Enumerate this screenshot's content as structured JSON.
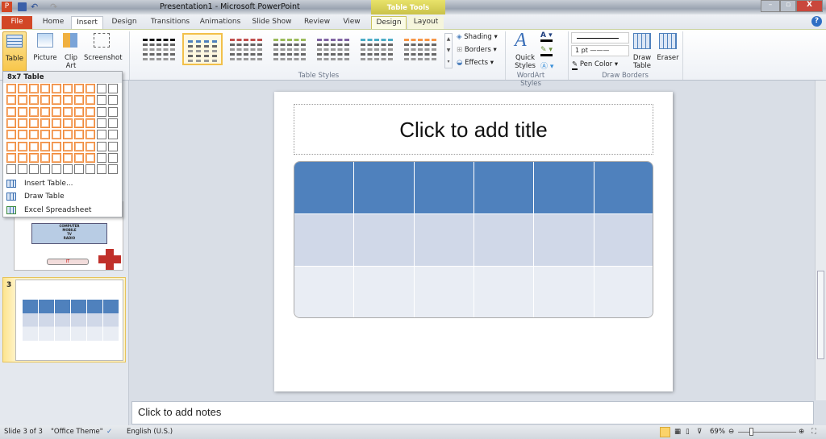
{
  "window": {
    "title": "Presentation1 - Microsoft PowerPoint",
    "contextual_group": "Table Tools"
  },
  "tabs": [
    "File",
    "Home",
    "Insert",
    "Design",
    "Transitions",
    "Animations",
    "Slide Show",
    "Review",
    "View",
    "Design",
    "Layout"
  ],
  "ribbon": {
    "tables": {
      "table": "Table",
      "picture": "Picture",
      "clip_art": "Clip Art",
      "screenshot": "Screenshot"
    },
    "table_styles_label": "Table Styles",
    "style_colors": [
      "#111111",
      "#4f81bd",
      "#c0504d",
      "#9bbb59",
      "#8064a2",
      "#4bacc6",
      "#f79646"
    ],
    "shading": "Shading",
    "borders": "Borders",
    "effects": "Effects",
    "quick_styles": "Quick Styles",
    "wordart_label": "WordArt Styles",
    "pen_weight": "1 pt",
    "pen_color": "Pen Color",
    "draw_table": "Draw Table",
    "eraser": "Eraser",
    "draw_borders_label": "Draw Borders"
  },
  "insert_table_menu": {
    "header": "8x7 Table",
    "grid_cols": 10,
    "grid_rows": 8,
    "selected_cols": 8,
    "selected_rows": 7,
    "items": [
      "Insert Table...",
      "Draw Table",
      "Excel Spreadsheet"
    ]
  },
  "thumbnails": {
    "slide2_text": [
      "COMPUTER",
      "MOBILE",
      "TV",
      "RADIO"
    ],
    "slide2_label": "IT",
    "slide3_number": "3"
  },
  "slide": {
    "title_placeholder": "Click to add title",
    "table": {
      "columns": 6,
      "rows": 3,
      "colors": [
        "#4f81bd",
        "#d0d8e8",
        "#e9edf4"
      ]
    }
  },
  "notes_placeholder": "Click to add notes",
  "status": {
    "slide": "Slide 3 of 3",
    "theme": "\"Office Theme\"",
    "language": "English (U.S.)",
    "zoom": "69%",
    "zoom_percent": 69
  }
}
